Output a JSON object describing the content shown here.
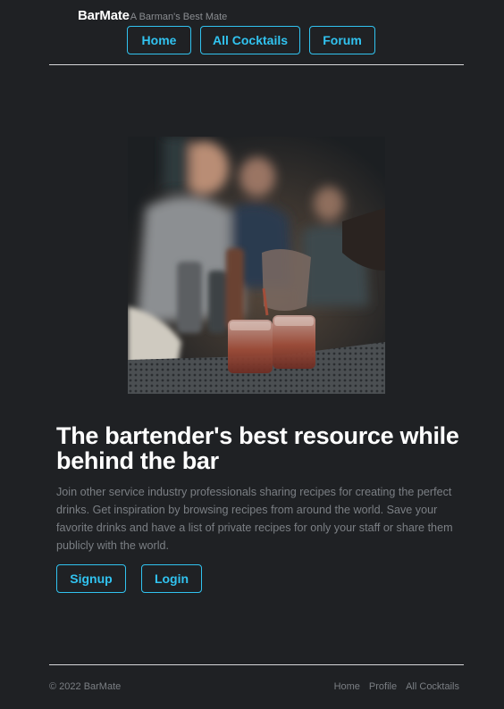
{
  "header": {
    "brand_name": "BarMate",
    "tagline": "A Barman's Best Mate",
    "nav": {
      "home": "Home",
      "all_cocktails": "All Cocktails",
      "forum": "Forum"
    }
  },
  "hero": {
    "image_alt": "Bartender pouring cocktails",
    "title": "The bartender's best resource while behind the bar",
    "description": "Join other service industry professionals sharing recipes for creating the perfect drinks. Get inspiration by browsing recipes from around the world. Save your favorite drinks and have a list of private recipes for only your staff or share them publicly with the world.",
    "signup_label": "Signup",
    "login_label": "Login"
  },
  "footer": {
    "copyright": "© 2022 BarMate",
    "links": {
      "home": "Home",
      "profile": "Profile",
      "all_cocktails": "All Cocktails"
    }
  },
  "colors": {
    "background": "#1f2124",
    "accent": "#31c3f0",
    "muted_text": "#7b7f84"
  }
}
